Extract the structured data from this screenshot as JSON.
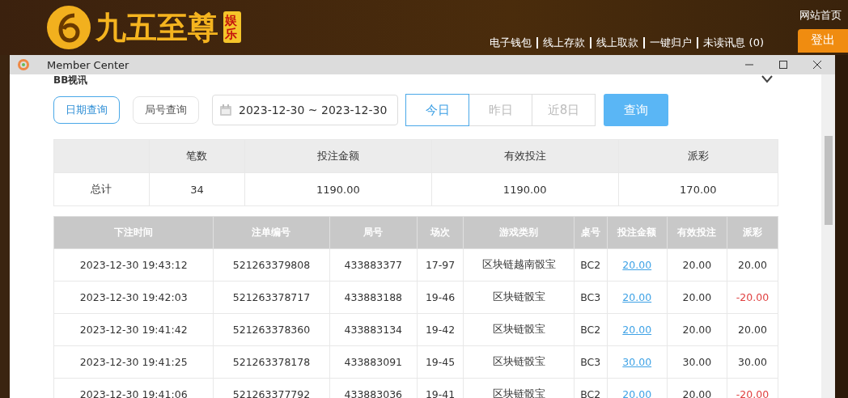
{
  "site": {
    "logo_text": "九五至尊",
    "logo_badge": "娱乐",
    "top_link": "网站首页",
    "nav": [
      "电子钱包",
      "线上存款",
      "线上取款",
      "一键归户",
      "未读讯息 (0)"
    ],
    "logout": "登出"
  },
  "window": {
    "title": "Member Center"
  },
  "panel": {
    "title": "BB视讯"
  },
  "search_modes": [
    {
      "label": "日期查询",
      "selected": true
    },
    {
      "label": "局号查询",
      "selected": false
    }
  ],
  "date_range": {
    "value": "2023-12-30 ~ 2023-12-30"
  },
  "quick_ranges": [
    {
      "label": "今日",
      "selected": true
    },
    {
      "label": "昨日",
      "selected": false
    },
    {
      "label": "近8日",
      "selected": false
    }
  ],
  "query_button": "查询",
  "summary": {
    "columns": [
      "笔数",
      "投注金额",
      "有效投注",
      "派彩"
    ],
    "row_label": "总计",
    "values": [
      "34",
      "1190.00",
      "1190.00",
      "170.00"
    ]
  },
  "table": {
    "columns": [
      "下注时间",
      "注单编号",
      "局号",
      "场次",
      "游戏类别",
      "桌号",
      "投注金额",
      "有效投注",
      "派彩"
    ],
    "rows": [
      {
        "time": "2023-12-30 19:43:12",
        "bet_id": "521263379808",
        "round": "433883377",
        "session": "17-97",
        "game": "区块链越南骰宝",
        "table": "BC2",
        "amount": "20.00",
        "valid": "20.00",
        "payout": "20.00",
        "loss": false
      },
      {
        "time": "2023-12-30 19:42:03",
        "bet_id": "521263378717",
        "round": "433883188",
        "session": "19-46",
        "game": "区块链骰宝",
        "table": "BC3",
        "amount": "20.00",
        "valid": "20.00",
        "payout": "-20.00",
        "loss": true
      },
      {
        "time": "2023-12-30 19:41:42",
        "bet_id": "521263378360",
        "round": "433883134",
        "session": "19-42",
        "game": "区块链骰宝",
        "table": "BC2",
        "amount": "20.00",
        "valid": "20.00",
        "payout": "20.00",
        "loss": false
      },
      {
        "time": "2023-12-30 19:41:25",
        "bet_id": "521263378178",
        "round": "433883091",
        "session": "19-45",
        "game": "区块链骰宝",
        "table": "BC3",
        "amount": "30.00",
        "valid": "30.00",
        "payout": "30.00",
        "loss": false
      },
      {
        "time": "2023-12-30 19:41:06",
        "bet_id": "521263377792",
        "round": "433883036",
        "session": "19-41",
        "game": "区块链骰宝",
        "table": "BC2",
        "amount": "20.00",
        "valid": "20.00",
        "payout": "-20.00",
        "loss": true
      }
    ]
  }
}
